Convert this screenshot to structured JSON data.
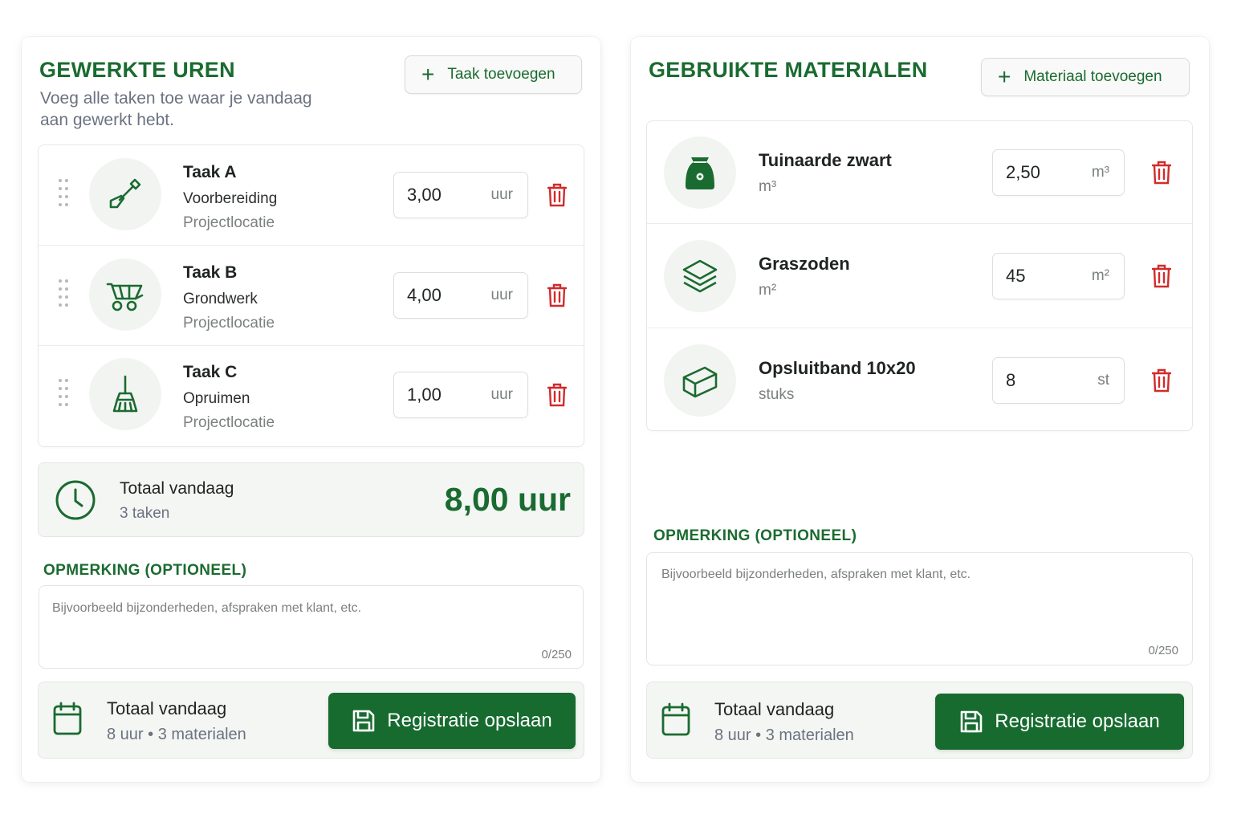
{
  "colors": {
    "accent": "#1a6b30",
    "danger": "#d12b2b",
    "muted": "#6b7280"
  },
  "hours": {
    "title": "GEWERKTE UREN",
    "subtitle": "Voeg alle taken toe waar je vandaag aan gewerkt hebt.",
    "add_label": "Taak toevoegen",
    "tasks": [
      {
        "title": "Taak A",
        "activity": "Voorbereiding",
        "location": "Projectlocatie",
        "value": "3,00",
        "unit": "uur",
        "icon": "shovel-icon"
      },
      {
        "title": "Taak B",
        "activity": "Grondwerk",
        "location": "Projectlocatie",
        "value": "4,00",
        "unit": "uur",
        "icon": "wheelbarrow-icon"
      },
      {
        "title": "Taak C",
        "activity": "Opruimen",
        "location": "Projectlocatie",
        "value": "1,00",
        "unit": "uur",
        "icon": "broom-icon"
      }
    ],
    "total": {
      "label": "Totaal vandaag",
      "sub": "3 taken",
      "value": "8,00 uur"
    },
    "note": {
      "label": "OPMERKING (OPTIONEEL)",
      "placeholder": "Bijvoorbeeld bijzonderheden, afspraken met klant, etc.",
      "count": "0/250"
    },
    "footer": {
      "label": "Totaal vandaag",
      "sub": "8 uur • 3 materialen",
      "save_label": "Registratie opslaan"
    }
  },
  "materials": {
    "title": "GEBRUIKTE MATERIALEN",
    "add_label": "Materiaal toevoegen",
    "items": [
      {
        "name": "Tuinaarde zwart",
        "unit_label": "m³",
        "value": "2,50",
        "unit": "m³",
        "icon": "soil-bag-icon"
      },
      {
        "name": "Graszoden",
        "unit_label": "m²",
        "value": "45",
        "unit": "m²",
        "icon": "layers-icon"
      },
      {
        "name": "Opsluitband 10x20",
        "unit_label": "stuks",
        "value": "8",
        "unit": "st",
        "icon": "block-icon"
      }
    ],
    "note": {
      "label": "OPMERKING (OPTIONEEL)",
      "placeholder": "Bijvoorbeeld bijzonderheden, afspraken met klant, etc.",
      "count": "0/250"
    },
    "footer": {
      "label": "Totaal vandaag",
      "sub": "8 uur • 3 materialen",
      "save_label": "Registratie opslaan"
    }
  }
}
